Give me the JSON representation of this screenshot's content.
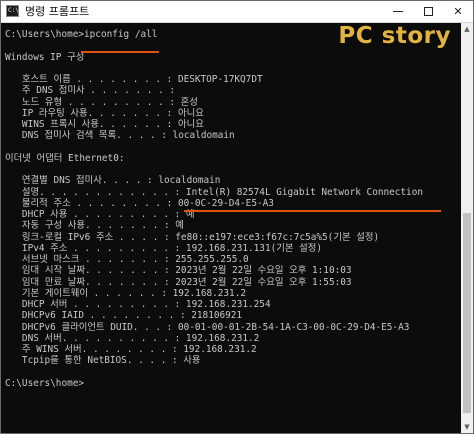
{
  "window": {
    "title": "명령 프롬프트",
    "icon_label": "C:\\",
    "app_icon": "cmd-icon",
    "minimize_icon": "minimize-icon",
    "maximize_icon": "maximize-icon",
    "close_icon": "close-icon",
    "close_glyph": "✕"
  },
  "watermark": "PC story",
  "colors": {
    "console_background": "#0c0c0c",
    "console_text": "#c8c8c8",
    "highlight_underline": "#e05212",
    "watermark": "#e2b33f"
  },
  "console": {
    "lines": [
      "C:\\Users\\home>ipconfig /all",
      "",
      "Windows IP 구성",
      "",
      "   호스트 이름 . . . . . . . . : DESKTOP-17KQ7DT",
      "   주 DNS 접미사 . . . . . . . :",
      "   노드 유형 . . . . . . . . . : 혼성",
      "   IP 라우팅 사용. . . . . . . : 아니요",
      "   WINS 프록시 사용. . . . . . : 아니요",
      "   DNS 접미사 검색 목록. . . . : localdomain",
      "",
      "이더넷 어댑터 Ethernet0:",
      "",
      "   연결별 DNS 접미사. . . . : localdomain",
      "   설명. . . . . . . . . . . . : Intel(R) 82574L Gigabit Network Connection",
      "   물리적 주소 . . . . . . . . : 00-0C-29-D4-E5-A3",
      "   DHCP 사용 . . . . . . . . . : 예",
      "   자동 구성 사용. . . . . . . : 예",
      "   링크-로컬 IPv6 주소 . . . . : fe80::e197:ece3:f67c:7c5a%5(기본 설정)",
      "   IPv4 주소 . . . . . . . . . : 192.168.231.131(기본 설정)",
      "   서브넷 마스크 . . . . . . . : 255.255.255.0",
      "   임대 시작 날짜. . . . . . . : 2023년 2월 22일 수요일 오후 1:10:03",
      "   임대 만료 날짜. . . . . . . : 2023년 2월 22일 수요일 오후 1:55:03",
      "   기본 게이트웨이 . . . . . . : 192.168.231.2",
      "   DHCP 서버 . . . . . . . . . : 192.168.231.254",
      "   DHCPv6 IAID . . . . . . . . : 218106921",
      "   DHCPv6 클라이언트 DUID. . . : 00-01-00-01-2B-54-1A-C3-00-0C-29-D4-E5-A3",
      "   DNS 서버. . . . . . . . . . : 192.168.231.2",
      "   주 WINS 서버. . . . . . . . : 192.168.231.2",
      "   Tcpip를 통한 NetBIOS. . . . : 사용",
      "",
      "C:\\Users\\home>"
    ]
  }
}
